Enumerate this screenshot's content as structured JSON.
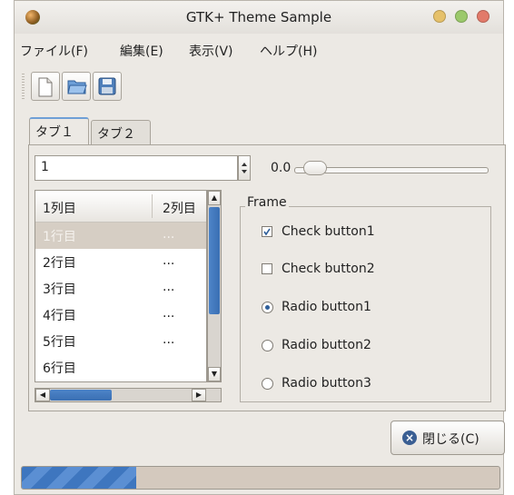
{
  "window": {
    "title": "GTK+ Theme Sample"
  },
  "menu": {
    "items": [
      {
        "label": "ファイル(F)"
      },
      {
        "label": "編集(E)"
      },
      {
        "label": "表示(V)"
      },
      {
        "label": "ヘルプ(H)"
      }
    ]
  },
  "toolbar": {
    "icons": [
      "new-document-icon",
      "open-folder-icon",
      "save-icon"
    ]
  },
  "tabs": [
    {
      "label": "タブ１"
    },
    {
      "label": "タブ２"
    }
  ],
  "spin": {
    "value": "1"
  },
  "scale": {
    "value_label": "0.0",
    "value": 0.0
  },
  "tree": {
    "headers": [
      "1列目",
      "2列目"
    ],
    "rows": [
      {
        "c1": "1行目",
        "c2": "...",
        "selected": true
      },
      {
        "c1": "2行目",
        "c2": "..."
      },
      {
        "c1": "3行目",
        "c2": "..."
      },
      {
        "c1": "4行目",
        "c2": "..."
      },
      {
        "c1": "5行目",
        "c2": "..."
      },
      {
        "c1": "6行目",
        "c2": ""
      }
    ]
  },
  "frame": {
    "label": "Frame",
    "checks": [
      {
        "label": "Check button1",
        "checked": true
      },
      {
        "label": "Check button2",
        "checked": false
      }
    ],
    "radios": [
      {
        "label": "Radio button1",
        "selected": true
      },
      {
        "label": "Radio button2",
        "selected": false
      },
      {
        "label": "Radio button3",
        "selected": false
      }
    ]
  },
  "close_button": {
    "label": "閉じる(C)"
  },
  "progress": {
    "fraction": 0.24
  },
  "colors": {
    "accent": "#3e76bf",
    "selection": "#d6cec4"
  }
}
